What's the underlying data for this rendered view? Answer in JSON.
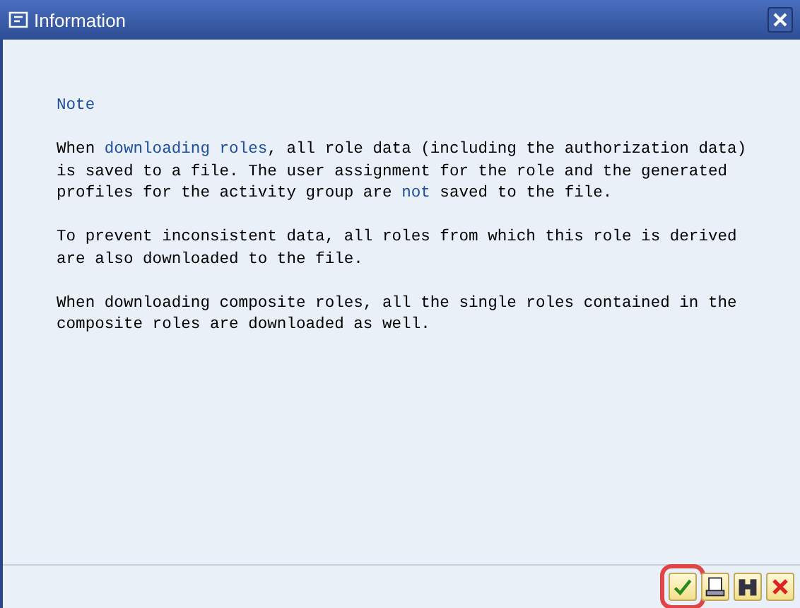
{
  "window": {
    "title": "Information"
  },
  "heading": "Note",
  "paragraphs": [
    [
      {
        "text": "When ",
        "link": false
      },
      {
        "text": "downloading roles",
        "link": true
      },
      {
        "text": ", all role data (including the authorization data)\nis saved to a file. The user assignment for the role and the generated\nprofiles for the activity group are ",
        "link": false
      },
      {
        "text": "not",
        "link": true
      },
      {
        "text": " saved to the file.",
        "link": false
      }
    ],
    [
      {
        "text": "To prevent inconsistent data, all roles from which this role is derived\nare also downloaded to the file.",
        "link": false
      }
    ],
    [
      {
        "text": "When downloading composite roles, all the single roles contained in the\ncomposite roles are downloaded as well.",
        "link": false
      }
    ]
  ],
  "buttons": [
    {
      "kind": "confirm",
      "highlighted": true
    },
    {
      "kind": "document",
      "highlighted": false
    },
    {
      "kind": "find",
      "highlighted": false
    },
    {
      "kind": "cancel",
      "highlighted": false
    }
  ]
}
